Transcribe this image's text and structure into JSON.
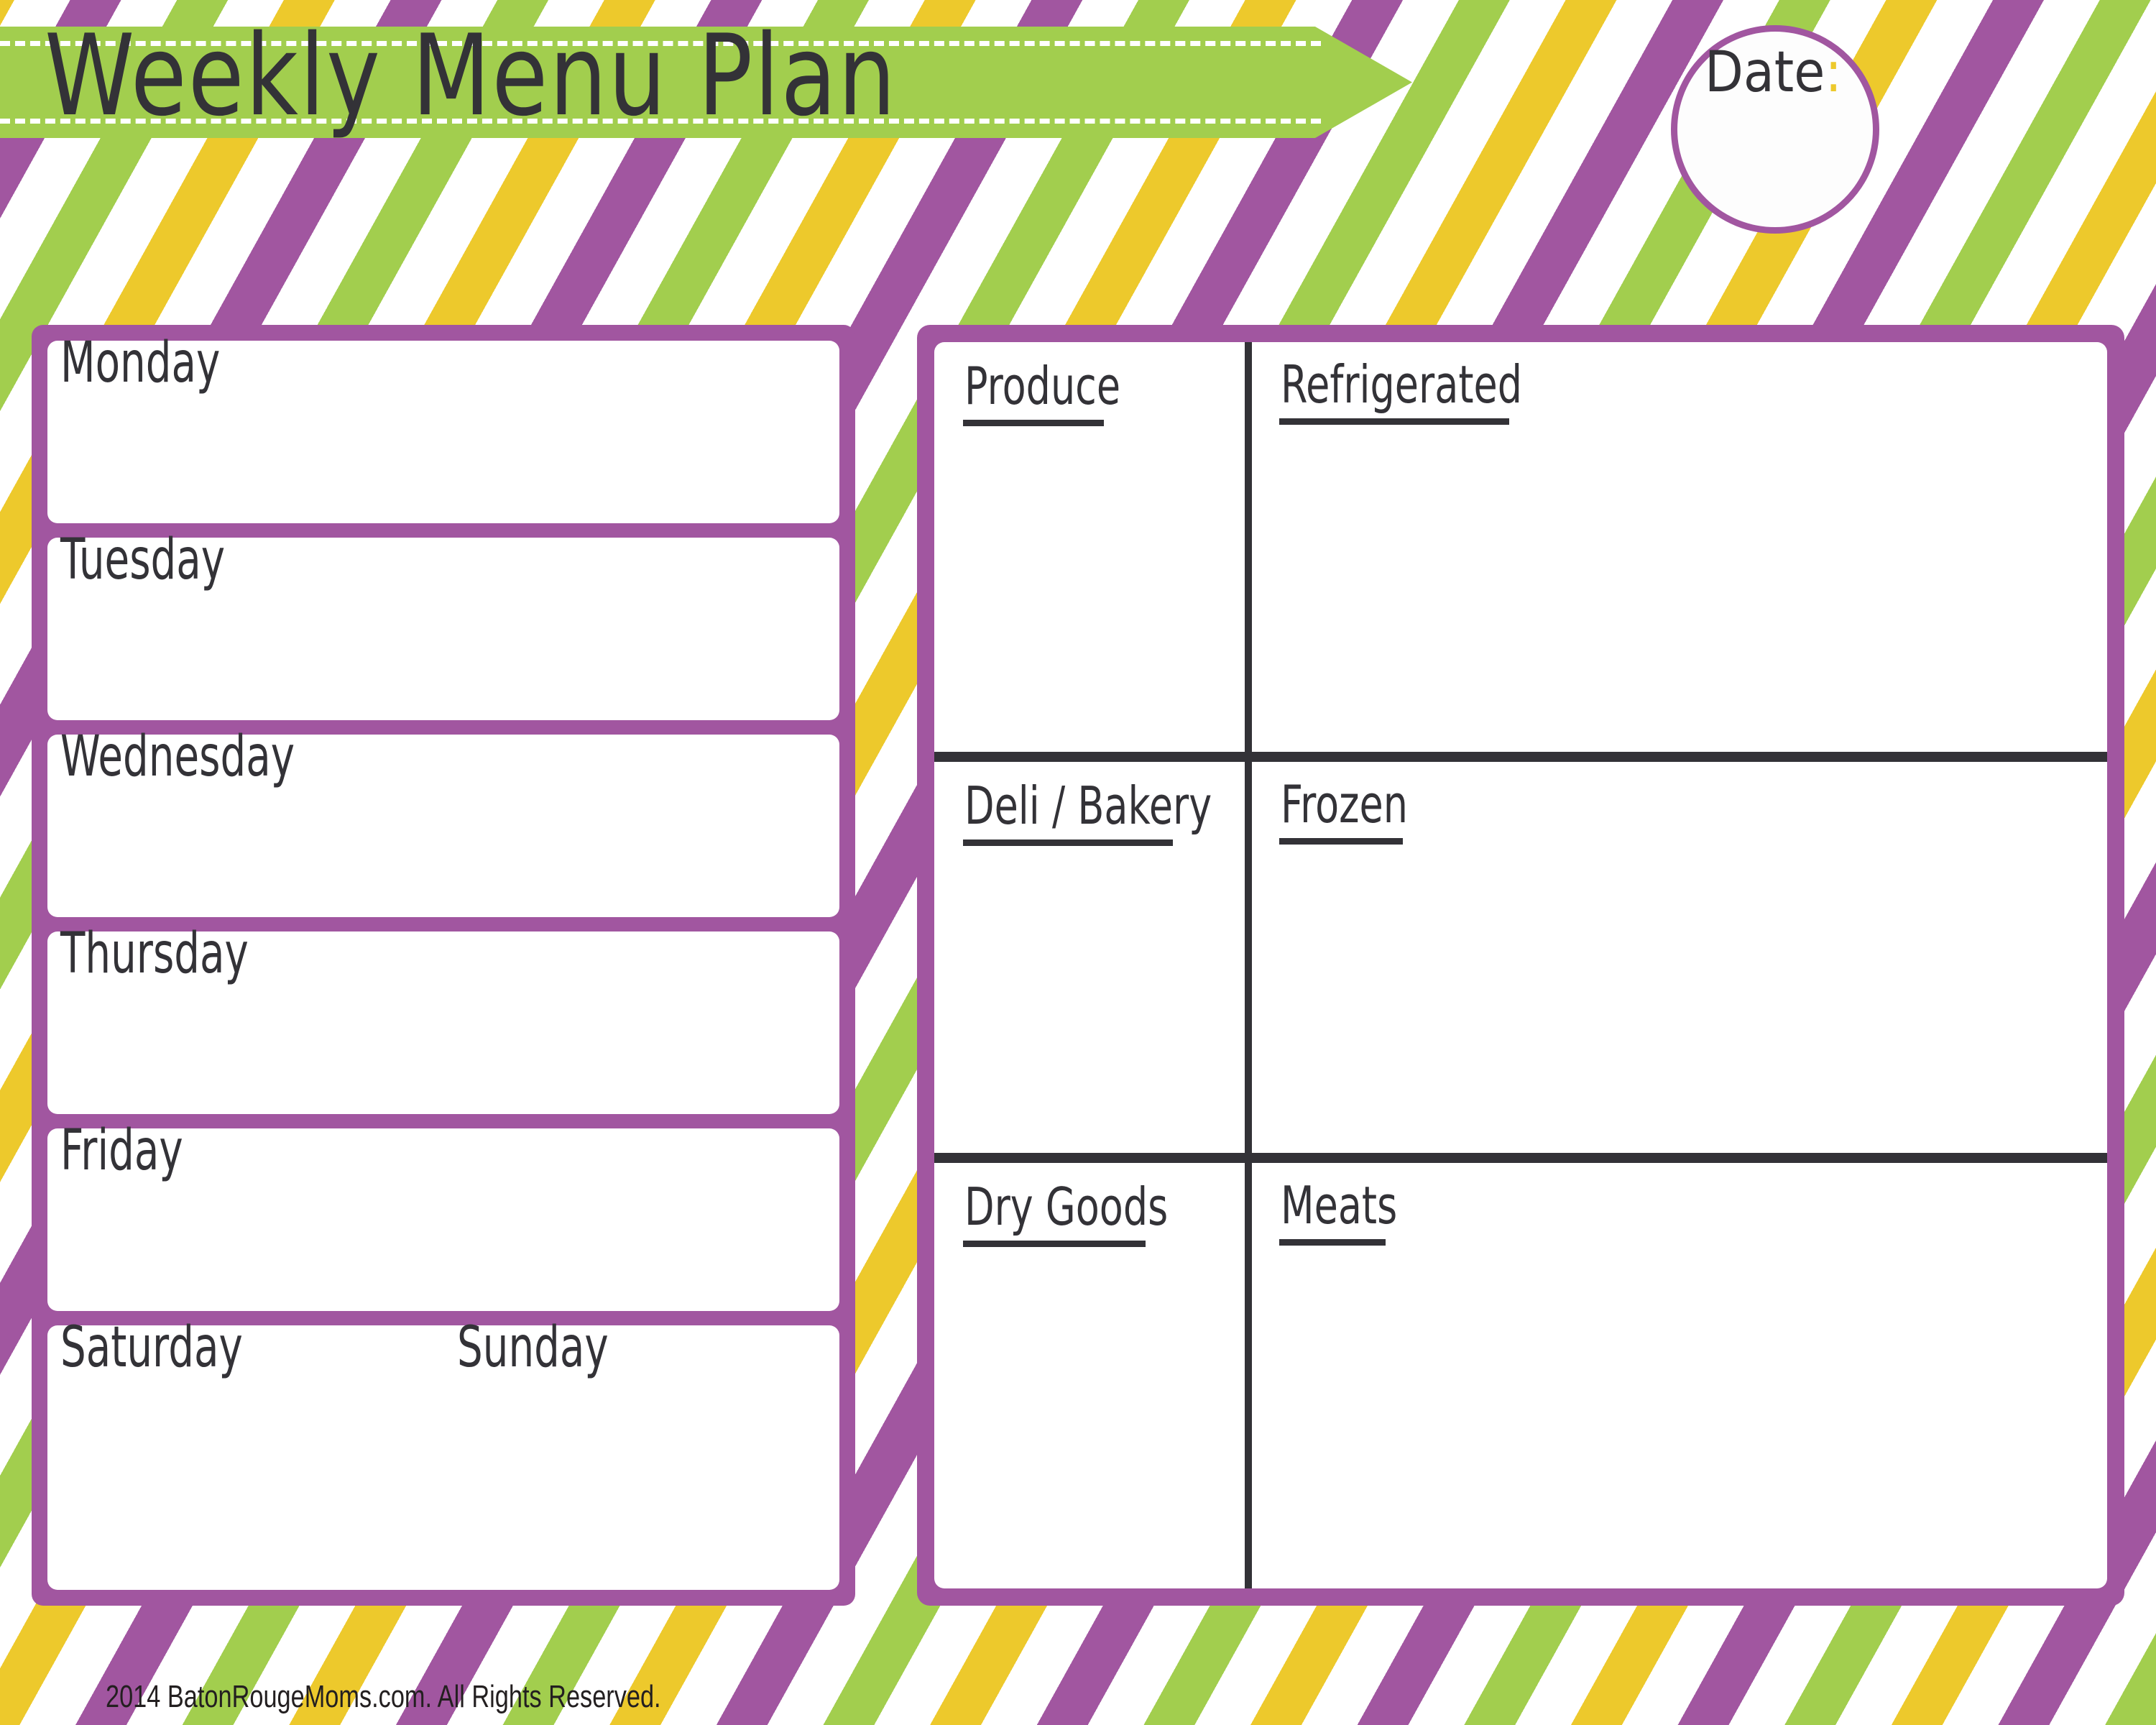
{
  "page": {
    "title": "Weekly Menu Plan",
    "date_label": "Date",
    "date_colon": ":",
    "date_value": "",
    "copyright": "2014 BatonRougeMoms.com. All Rights Reserved."
  },
  "colors": {
    "purple": "#a156a0",
    "green": "#a2ce4e",
    "yellow": "#edc92c",
    "ink": "#333237",
    "white": "#ffffff"
  },
  "days": [
    {
      "label": "Monday",
      "value": ""
    },
    {
      "label": "Tuesday",
      "value": ""
    },
    {
      "label": "Wednesday",
      "value": ""
    },
    {
      "label": "Thursday",
      "value": ""
    },
    {
      "label": "Friday",
      "value": ""
    },
    {
      "label": "Saturday",
      "value": ""
    },
    {
      "label": "Sunday",
      "value": ""
    }
  ],
  "grocery": {
    "categories": [
      {
        "label": "Produce",
        "value": ""
      },
      {
        "label": "Refrigerated",
        "value": ""
      },
      {
        "label": "Deli / Bakery",
        "value": ""
      },
      {
        "label": "Frozen",
        "value": ""
      },
      {
        "label": "Dry Goods",
        "value": ""
      },
      {
        "label": "Meats",
        "value": ""
      }
    ]
  }
}
